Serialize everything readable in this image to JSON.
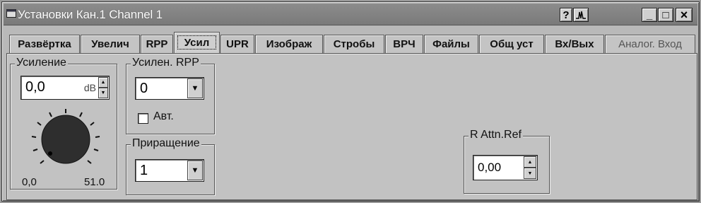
{
  "window": {
    "title": "Установки Кан.1 Channel 1",
    "help_label": "?",
    "wave_label": "⁄/ᛋ",
    "minimize_label": "_",
    "maximize_label": "□",
    "close_label": "×"
  },
  "tabs": [
    {
      "label": "Развёртка"
    },
    {
      "label": "Увелич"
    },
    {
      "label": "RPP"
    },
    {
      "label": "Усил",
      "active": true
    },
    {
      "label": "UPR"
    },
    {
      "label": "Изображ"
    },
    {
      "label": "Стробы"
    },
    {
      "label": "ВРЧ"
    },
    {
      "label": "Файлы"
    },
    {
      "label": "Общ уст"
    },
    {
      "label": "Вх/Вых"
    },
    {
      "label": "Аналог. Вход",
      "disabled": true
    }
  ],
  "gain": {
    "group_label": "Усиление",
    "value": "0,0",
    "unit": "dB",
    "knob_min": "0,0",
    "knob_max": "51.0"
  },
  "rpp_gain": {
    "group_label": "Усилен. RPP",
    "value": "0",
    "auto_label": "Авт.",
    "auto_checked": false
  },
  "increment": {
    "group_label": "Приращение",
    "value": "1"
  },
  "attn_ref": {
    "group_label": "R Attn.Ref",
    "value": "0,00"
  }
}
